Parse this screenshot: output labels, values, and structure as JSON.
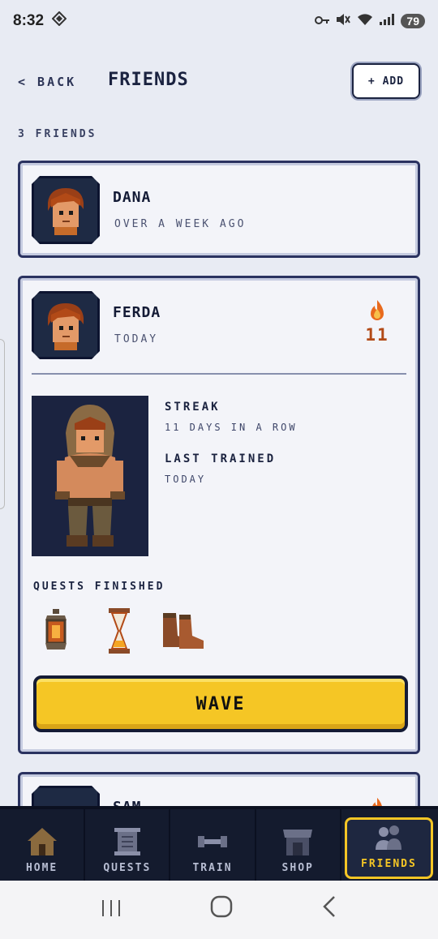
{
  "status_bar": {
    "time": "8:32",
    "battery": "79"
  },
  "header": {
    "back_label": "< BACK",
    "title": "FRIENDS",
    "add_label": "+ ADD"
  },
  "friends_count": "3 FRIENDS",
  "friends": [
    {
      "name": "DANA",
      "last_seen": "OVER A WEEK AGO"
    },
    {
      "name": "FERDA",
      "last_seen": "TODAY",
      "streak": "11",
      "streak_label": "STREAK",
      "streak_value": "11 DAYS IN A ROW",
      "last_trained_label": "LAST TRAINED",
      "last_trained_value": "TODAY",
      "quests_label": "QUESTS FINISHED",
      "quests": [
        "lantern-icon",
        "hourglass-icon",
        "boots-icon"
      ],
      "wave_label": "WAVE"
    },
    {
      "name": "SAM"
    }
  ],
  "nav": {
    "items": [
      {
        "label": "HOME",
        "icon": "house-icon"
      },
      {
        "label": "QUESTS",
        "icon": "scroll-icon"
      },
      {
        "label": "TRAIN",
        "icon": "dumbbell-icon"
      },
      {
        "label": "SHOP",
        "icon": "shop-icon"
      },
      {
        "label": "FRIENDS",
        "icon": "friends-icon"
      }
    ],
    "active": "FRIENDS"
  },
  "colors": {
    "accent": "#f5c625",
    "dark": "#1b2340",
    "streak": "#b24a17"
  }
}
